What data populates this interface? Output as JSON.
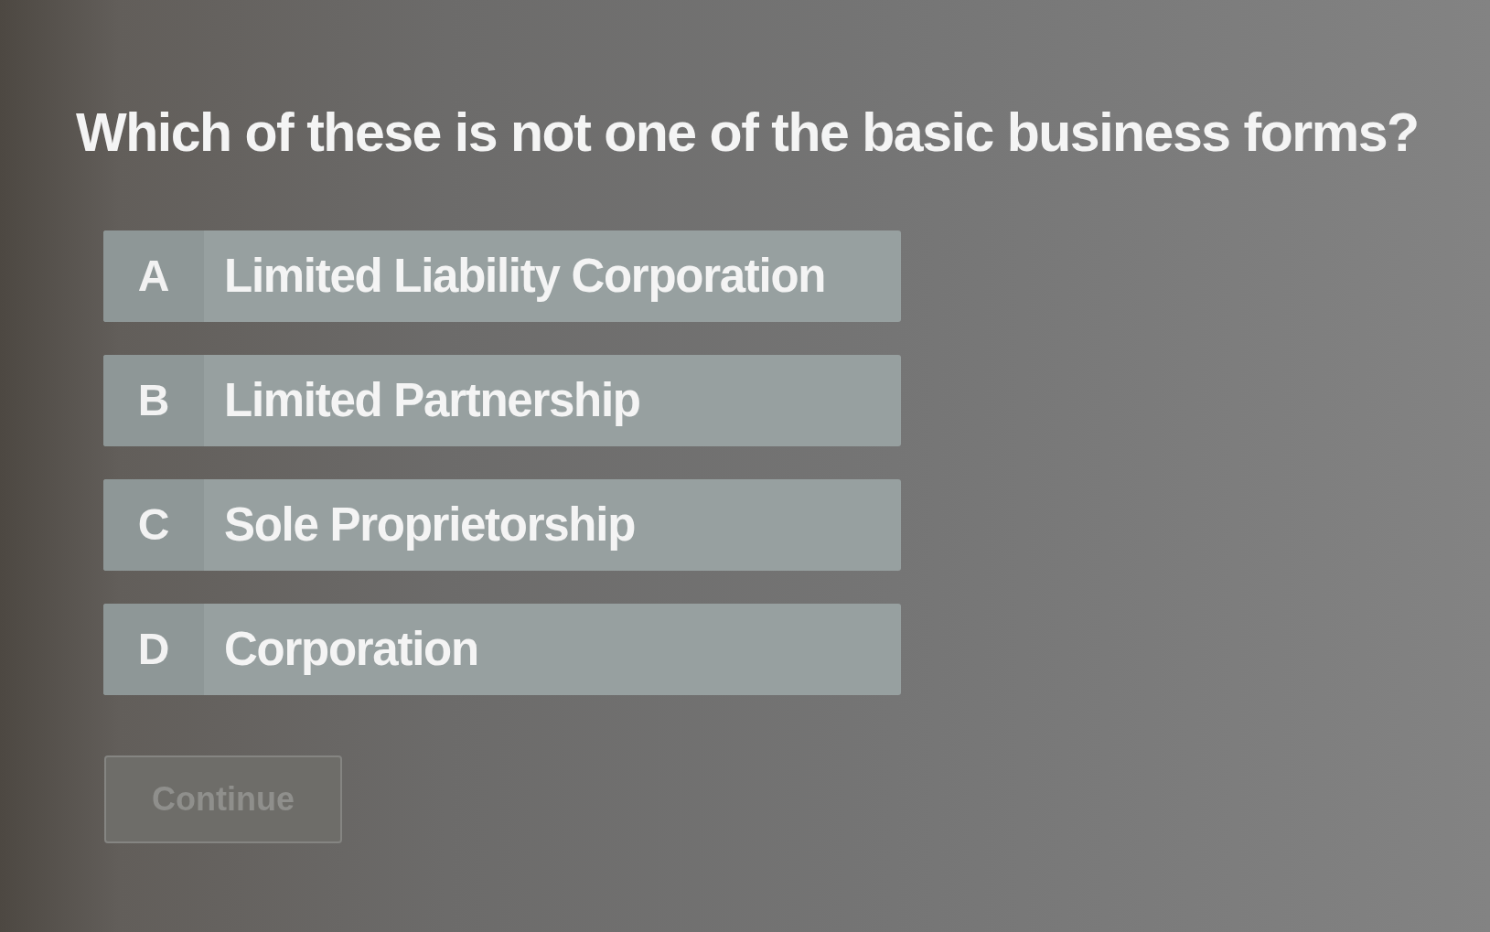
{
  "question": "Which of these is not one of the basic business forms?",
  "options": [
    {
      "letter": "A",
      "label": "Limited Liability Corporation",
      "selected": false
    },
    {
      "letter": "B",
      "label": "Limited Partnership",
      "selected": false
    },
    {
      "letter": "C",
      "label": "Sole Proprietorship",
      "selected": false
    },
    {
      "letter": "D",
      "label": "Corporation",
      "selected": false
    }
  ],
  "continue_button": {
    "label": "Continue",
    "disabled": true
  }
}
